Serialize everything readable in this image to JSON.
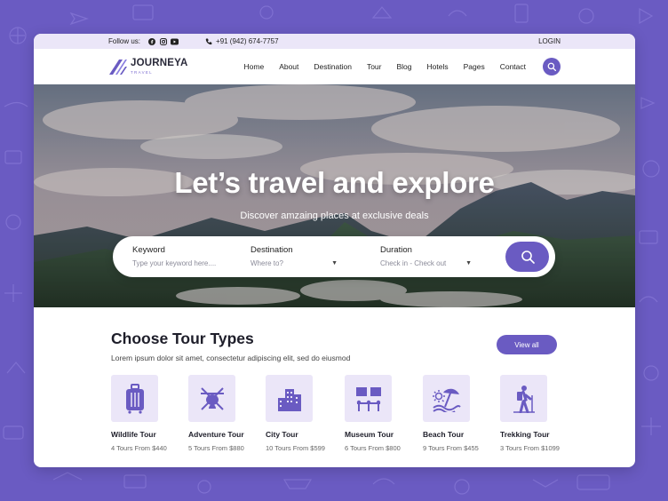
{
  "colors": {
    "accent": "#6a5bc2",
    "accent_light": "#ebe6f8",
    "text_dark": "#1e1e2a"
  },
  "topbar": {
    "follow_label": "Follow us:",
    "socials": [
      "facebook-icon",
      "instagram-icon",
      "youtube-icon"
    ],
    "phone": "+91 (942) 674-7757",
    "login": "LOGIN"
  },
  "brand": {
    "name": "JOURNEYA",
    "tagline": "TRAVEL"
  },
  "nav": {
    "items": [
      "Home",
      "About",
      "Destination",
      "Tour",
      "Blog",
      "Hotels",
      "Pages",
      "Contact"
    ]
  },
  "hero": {
    "title": "Let’s travel and explore",
    "subtitle": "Discover amzaing places at exclusive deals"
  },
  "search": {
    "keyword": {
      "label": "Keyword",
      "placeholder": "Type your keyword here...."
    },
    "destination": {
      "label": "Destination",
      "value": "Where to?"
    },
    "duration": {
      "label": "Duration",
      "value": "Check in - Check out"
    },
    "button_icon": "search-icon"
  },
  "tour_types": {
    "title": "Choose Tour Types",
    "description": "Lorem ipsum dolor sit amet, consectetur adipiscing elit, sed do eiusmod",
    "view_all": "View all",
    "items": [
      {
        "name": "Wildlife Tour",
        "meta": "4 Tours From  $440",
        "icon": "luggage-icon"
      },
      {
        "name": "Adventure Tour",
        "meta": "5 Tours From  $880",
        "icon": "campfire-icon"
      },
      {
        "name": "City Tour",
        "meta": "10 Tours From  $599",
        "icon": "city-buildings-icon"
      },
      {
        "name": "Museum Tour",
        "meta": "6 Tours From  $800",
        "icon": "museum-exhibit-icon"
      },
      {
        "name": "Beach Tour",
        "meta": "9 Tours From  $455",
        "icon": "beach-umbrella-icon"
      },
      {
        "name": "Trekking Tour",
        "meta": "3 Tours From  $1099",
        "icon": "hiker-icon"
      }
    ]
  }
}
